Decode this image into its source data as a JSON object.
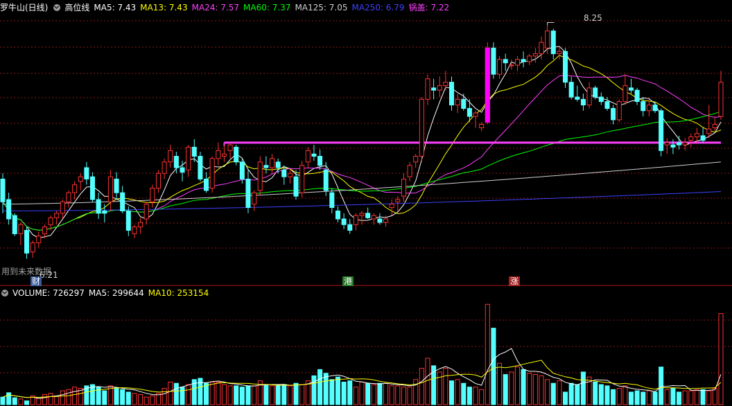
{
  "header": {
    "stock_label": "罗牛山(日线)",
    "indicator_name": "高位线",
    "ma_labels": [
      {
        "text": "MA5: 7.43",
        "color": "#ffffff"
      },
      {
        "text": "MA13: 7.43",
        "color": "#ffff00"
      },
      {
        "text": "MA24: 7.57",
        "color": "#ff40ff"
      },
      {
        "text": "MA60: 7.37",
        "color": "#00ff00"
      },
      {
        "text": "MA125: 7.05",
        "color": "#d0d0d0"
      },
      {
        "text": "MA250: 6.79",
        "color": "#4040ff"
      },
      {
        "text": "锅盖: 7.22",
        "color": "#ff40ff"
      }
    ]
  },
  "annotations": {
    "high_label": "8.25",
    "low_label": "6.21",
    "future_data_note": "用到未来数据",
    "marker_cai": "财",
    "marker_gang": "港",
    "marker_zhang": "涨"
  },
  "volume_header": {
    "title": "VOLUME: 726297",
    "ma5": "MA5: 299644",
    "ma10": "MA10: 253154"
  },
  "colors": {
    "up": "#ff3232",
    "down": "#54ffff",
    "grid": "#8c1a1a",
    "ma5": "#ffffff",
    "ma13": "#ffff00",
    "ma24": "#ff40ff",
    "ma60": "#00ff00",
    "ma125": "#d0d0d0",
    "ma250": "#4040ff",
    "guogai": "#ff40ff"
  },
  "chart_data": [
    {
      "type": "candlestick",
      "panel": "price",
      "ylim": [
        6.1,
        8.35
      ],
      "guogai_level": 7.22,
      "highest": 8.25,
      "lowest": 6.21,
      "candles": [
        [
          6.9,
          6.95,
          6.6,
          6.7
        ],
        [
          6.72,
          6.78,
          6.5,
          6.55
        ],
        [
          6.58,
          6.6,
          6.4,
          6.42
        ],
        [
          6.42,
          6.52,
          6.32,
          6.5
        ],
        [
          6.45,
          6.48,
          6.2,
          6.25
        ],
        [
          6.26,
          6.36,
          6.21,
          6.34
        ],
        [
          6.34,
          6.44,
          6.3,
          6.4
        ],
        [
          6.42,
          6.5,
          6.38,
          6.48
        ],
        [
          6.5,
          6.58,
          6.45,
          6.56
        ],
        [
          6.56,
          6.62,
          6.5,
          6.6
        ],
        [
          6.6,
          6.72,
          6.55,
          6.7
        ],
        [
          6.7,
          6.8,
          6.65,
          6.78
        ],
        [
          6.78,
          6.88,
          6.72,
          6.85
        ],
        [
          6.88,
          6.95,
          6.8,
          6.92
        ],
        [
          7.0,
          7.05,
          6.85,
          6.9
        ],
        [
          6.92,
          6.96,
          6.7,
          6.72
        ],
        [
          6.72,
          6.78,
          6.55,
          6.6
        ],
        [
          6.62,
          6.68,
          6.52,
          6.6
        ],
        [
          6.7,
          6.98,
          6.62,
          6.92
        ],
        [
          6.9,
          6.96,
          6.72,
          6.78
        ],
        [
          6.78,
          6.84,
          6.6,
          6.62
        ],
        [
          6.62,
          6.66,
          6.4,
          6.45
        ],
        [
          6.42,
          6.5,
          6.38,
          6.48
        ],
        [
          6.48,
          6.56,
          6.42,
          6.52
        ],
        [
          6.55,
          6.7,
          6.5,
          6.68
        ],
        [
          6.7,
          6.85,
          6.65,
          6.82
        ],
        [
          6.82,
          6.98,
          6.78,
          6.95
        ],
        [
          6.95,
          7.08,
          6.9,
          7.05
        ],
        [
          7.05,
          7.2,
          7.0,
          7.15
        ],
        [
          7.1,
          7.14,
          6.95,
          7.0
        ],
        [
          7.0,
          7.06,
          6.88,
          6.96
        ],
        [
          6.98,
          7.2,
          6.92,
          7.18
        ],
        [
          7.18,
          7.25,
          7.05,
          7.1
        ],
        [
          7.1,
          7.14,
          6.88,
          6.9
        ],
        [
          6.9,
          6.96,
          6.78,
          6.8
        ],
        [
          6.82,
          7.1,
          6.78,
          7.08
        ],
        [
          7.08,
          7.22,
          7.02,
          7.15
        ],
        [
          7.1,
          7.2,
          7.05,
          7.12
        ],
        [
          7.15,
          7.22,
          7.08,
          7.2
        ],
        [
          7.18,
          7.2,
          7.02,
          7.05
        ],
        [
          7.05,
          7.08,
          6.86,
          6.9
        ],
        [
          6.9,
          6.98,
          6.6,
          6.65
        ],
        [
          6.68,
          6.8,
          6.62,
          6.78
        ],
        [
          6.8,
          7.1,
          6.76,
          7.05
        ],
        [
          7.02,
          7.1,
          6.95,
          7.0
        ],
        [
          7.0,
          7.12,
          6.95,
          7.08
        ],
        [
          7.05,
          7.08,
          6.95,
          7.0
        ],
        [
          6.98,
          7.02,
          6.85,
          6.92
        ],
        [
          6.92,
          6.98,
          6.86,
          6.95
        ],
        [
          6.92,
          6.98,
          6.72,
          6.75
        ],
        [
          6.78,
          7.06,
          6.74,
          7.02
        ],
        [
          7.05,
          7.18,
          7.0,
          7.15
        ],
        [
          7.12,
          7.2,
          7.06,
          7.1
        ],
        [
          7.1,
          7.16,
          6.98,
          7.02
        ],
        [
          6.98,
          7.05,
          6.75,
          6.8
        ],
        [
          6.78,
          6.82,
          6.6,
          6.65
        ],
        [
          6.62,
          6.66,
          6.52,
          6.55
        ],
        [
          6.55,
          6.6,
          6.46,
          6.5
        ],
        [
          6.5,
          6.55,
          6.42,
          6.45
        ],
        [
          6.5,
          6.6,
          6.45,
          6.58
        ],
        [
          6.58,
          6.62,
          6.5,
          6.6
        ],
        [
          6.6,
          6.65,
          6.55,
          6.56
        ],
        [
          6.55,
          6.6,
          6.5,
          6.58
        ],
        [
          6.55,
          6.6,
          6.5,
          6.52
        ],
        [
          6.52,
          6.58,
          6.48,
          6.55
        ],
        [
          6.65,
          6.72,
          6.58,
          6.68
        ],
        [
          6.7,
          6.75,
          6.62,
          6.72
        ],
        [
          6.75,
          6.95,
          6.7,
          6.9
        ],
        [
          6.92,
          7.05,
          6.88,
          7.02
        ],
        [
          7.05,
          7.12,
          7.0,
          7.1
        ],
        [
          7.1,
          7.62,
          7.05,
          7.6
        ],
        [
          7.6,
          7.82,
          7.55,
          7.78
        ],
        [
          7.7,
          7.78,
          7.6,
          7.68
        ],
        [
          7.68,
          7.8,
          7.62,
          7.72
        ],
        [
          7.72,
          7.85,
          7.68,
          7.75
        ],
        [
          7.75,
          7.8,
          7.5,
          7.55
        ],
        [
          7.55,
          7.65,
          7.48,
          7.6
        ],
        [
          7.6,
          7.65,
          7.5,
          7.52
        ],
        [
          7.52,
          7.6,
          7.4,
          7.45
        ],
        [
          7.45,
          7.5,
          7.35,
          7.48
        ],
        [
          7.35,
          7.4,
          7.32,
          7.38
        ],
        [
          7.4,
          8.1,
          7.38,
          8.05
        ],
        [
          8.05,
          8.1,
          7.78,
          7.82
        ],
        [
          7.82,
          7.98,
          7.78,
          7.95
        ],
        [
          7.95,
          8.0,
          7.85,
          7.92
        ],
        [
          7.9,
          7.95,
          7.86,
          7.9
        ],
        [
          7.9,
          7.98,
          7.85,
          7.95
        ],
        [
          7.95,
          8.02,
          7.88,
          7.93
        ],
        [
          7.93,
          8.0,
          7.9,
          7.98
        ],
        [
          7.98,
          8.05,
          7.92,
          8.0
        ],
        [
          8.0,
          8.15,
          7.95,
          8.1
        ],
        [
          8.05,
          8.25,
          8.0,
          8.2
        ],
        [
          8.2,
          8.22,
          7.95,
          8.0
        ],
        [
          8.0,
          8.05,
          7.95,
          8.02
        ],
        [
          8.02,
          8.05,
          7.7,
          7.75
        ],
        [
          7.75,
          7.8,
          7.6,
          7.62
        ],
        [
          7.62,
          7.72,
          7.58,
          7.6
        ],
        [
          7.6,
          7.65,
          7.5,
          7.55
        ],
        [
          7.55,
          7.75,
          7.52,
          7.7
        ],
        [
          7.7,
          7.72,
          7.6,
          7.62
        ],
        [
          7.62,
          7.66,
          7.55,
          7.58
        ],
        [
          7.58,
          7.62,
          7.5,
          7.52
        ],
        [
          7.52,
          7.55,
          7.38,
          7.42
        ],
        [
          7.42,
          7.6,
          7.4,
          7.58
        ],
        [
          7.58,
          7.82,
          7.55,
          7.72
        ],
        [
          7.7,
          7.78,
          7.65,
          7.68
        ],
        [
          7.68,
          7.7,
          7.55,
          7.58
        ],
        [
          7.58,
          7.62,
          7.45,
          7.5
        ],
        [
          7.5,
          7.6,
          7.45,
          7.55
        ],
        [
          7.55,
          7.58,
          7.48,
          7.5
        ],
        [
          7.5,
          7.52,
          7.1,
          7.15
        ],
        [
          7.2,
          7.26,
          7.12,
          7.22
        ],
        [
          7.2,
          7.25,
          7.12,
          7.18
        ],
        [
          7.22,
          7.28,
          7.16,
          7.2
        ],
        [
          7.2,
          7.26,
          7.15,
          7.22
        ],
        [
          7.24,
          7.3,
          7.18,
          7.27
        ],
        [
          7.27,
          7.35,
          7.22,
          7.3
        ],
        [
          7.28,
          7.35,
          7.22,
          7.24
        ],
        [
          7.3,
          7.55,
          7.26,
          7.34
        ],
        [
          7.35,
          7.45,
          7.32,
          7.38
        ],
        [
          7.45,
          7.85,
          7.42,
          7.75
        ]
      ]
    },
    {
      "type": "bar",
      "panel": "volume",
      "ylim": [
        0,
        840000
      ],
      "values": [
        60000,
        95000,
        55000,
        45000,
        30000,
        70000,
        50000,
        80000,
        90000,
        65000,
        110000,
        120000,
        140000,
        130000,
        150000,
        160000,
        140000,
        110000,
        150000,
        130000,
        120000,
        100000,
        90000,
        80000,
        60000,
        70000,
        90000,
        130000,
        180000,
        170000,
        140000,
        160000,
        200000,
        210000,
        170000,
        180000,
        180000,
        160000,
        150000,
        150000,
        140000,
        150000,
        150000,
        190000,
        160000,
        150000,
        150000,
        160000,
        150000,
        170000,
        160000,
        190000,
        230000,
        280000,
        250000,
        200000,
        220000,
        180000,
        190000,
        140000,
        180000,
        170000,
        160000,
        170000,
        170000,
        150000,
        150000,
        140000,
        140000,
        200000,
        290000,
        370000,
        310000,
        260000,
        290000,
        190000,
        200000,
        170000,
        140000,
        140000,
        120000,
        800000,
        610000,
        330000,
        240000,
        260000,
        300000,
        280000,
        250000,
        240000,
        230000,
        200000,
        170000,
        190000,
        100000,
        170000,
        160000,
        260000,
        220000,
        180000,
        160000,
        150000,
        120000,
        130000,
        150000,
        100000,
        110000,
        100000,
        110000,
        100000,
        300000,
        120000,
        130000,
        100000,
        110000,
        110000,
        120000,
        120000,
        110000,
        130000,
        726297
      ]
    }
  ]
}
